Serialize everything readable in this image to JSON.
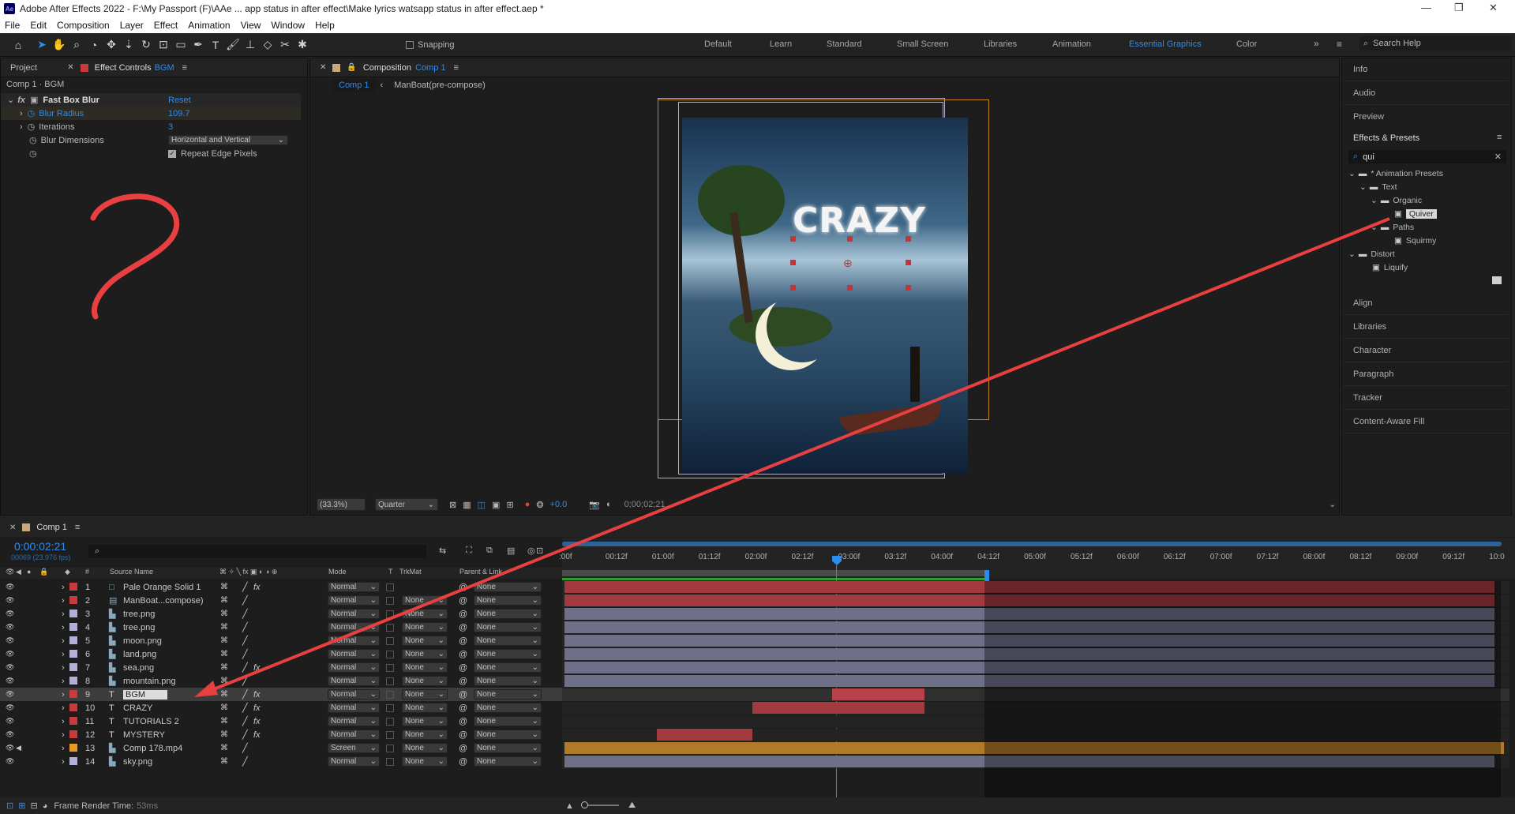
{
  "window": {
    "title": "Adobe After Effects 2022 - F:\\My Passport (F)\\AAe ... app status in after effect\\Make lyrics watsapp status in after effect.aep *",
    "app_badge": "Ae"
  },
  "menu": [
    "File",
    "Edit",
    "Composition",
    "Layer",
    "Effect",
    "Animation",
    "View",
    "Window",
    "Help"
  ],
  "toolbar": {
    "snapping": "Snapping"
  },
  "workspaces": [
    "Default",
    "Learn",
    "Standard",
    "Small Screen",
    "Libraries",
    "Animation",
    "Essential Graphics",
    "Color"
  ],
  "active_workspace": "Essential Graphics",
  "search_help": "Search Help",
  "left_panel": {
    "tabs": [
      "Project",
      "Effect Controls"
    ],
    "effect_controls_layer": "BGM",
    "path": "Comp 1 · BGM",
    "effect": {
      "name": "Fast Box Blur",
      "reset": "Reset",
      "props": [
        {
          "name": "Blur Radius",
          "value": "109.7"
        },
        {
          "name": "Iterations",
          "value": "3"
        },
        {
          "name": "Blur Dimensions",
          "value": "Horizontal and Vertical"
        }
      ],
      "repeat_edge": "Repeat Edge Pixels"
    }
  },
  "comp_panel": {
    "tab_label": "Composition",
    "comp_name": "Comp 1",
    "breadcrumbs": [
      "Comp 1",
      "ManBoat(pre-compose)"
    ],
    "canvas_text": "CRAZY",
    "zoom": "(33.3%)",
    "resolution": "Quarter",
    "exposure": "+0.0",
    "timecode": "0;00;02;21"
  },
  "right_panel": {
    "top_items": [
      "Info",
      "Audio",
      "Preview"
    ],
    "effects_presets": {
      "title": "Effects & Presets",
      "search": "qui",
      "tree": [
        {
          "label": "* Animation Presets",
          "depth": 0,
          "kind": "folder"
        },
        {
          "label": "Text",
          "depth": 1,
          "kind": "folder"
        },
        {
          "label": "Organic",
          "depth": 2,
          "kind": "folder"
        },
        {
          "label": "Quiver",
          "depth": 3,
          "kind": "preset",
          "selected": true
        },
        {
          "label": "Paths",
          "depth": 2,
          "kind": "folder"
        },
        {
          "label": "Squirmy",
          "depth": 3,
          "kind": "preset"
        },
        {
          "label": "Distort",
          "depth": 0,
          "kind": "folder"
        },
        {
          "label": "Liquify",
          "depth": 1,
          "kind": "preset"
        }
      ]
    },
    "bottom_items": [
      "Align",
      "Libraries",
      "Character",
      "Paragraph",
      "Tracker",
      "Content-Aware Fill"
    ]
  },
  "timeline": {
    "tab": "Comp 1",
    "timecode": "0:00:02:21",
    "frame_info": "00069 (23.976 fps)",
    "columns": {
      "source": "Source Name",
      "mode": "Mode",
      "t": "T",
      "trkmat": "TrkMat",
      "parent": "Parent & Link"
    },
    "ruler": [
      ":00f",
      "00:12f",
      "01:00f",
      "01:12f",
      "02:00f",
      "02:12f",
      "03:00f",
      "03:12f",
      "04:00f",
      "04:12f",
      "05:00f",
      "05:12f",
      "06:00f",
      "06:12f",
      "07:00f",
      "07:12f",
      "08:00f",
      "08:12f",
      "09:00f",
      "09:12f",
      "10:0"
    ],
    "layers": [
      {
        "num": "1",
        "name": "Pale Orange Solid 1",
        "type": "solid",
        "label": "#c93a3a",
        "mode": "Normal",
        "trk": "",
        "parent": "None",
        "bar": [
          0,
          0.99
        ],
        "barcolor": "#a23a3f",
        "fx": true
      },
      {
        "num": "2",
        "name": "ManBoat...compose)",
        "type": "comp",
        "label": "#c93a3a",
        "mode": "Normal",
        "trk": "None",
        "parent": "None",
        "bar": [
          0,
          0.99
        ],
        "barcolor": "#a23a3f",
        "fx": false
      },
      {
        "num": "3",
        "name": "tree.png",
        "type": "footage",
        "label": "#b0b0d8",
        "mode": "Normal",
        "trk": "None",
        "parent": "None",
        "bar": [
          0,
          0.99
        ],
        "barcolor": "#6e7088",
        "fx": false
      },
      {
        "num": "4",
        "name": "tree.png",
        "type": "footage",
        "label": "#b0b0d8",
        "mode": "Normal",
        "trk": "None",
        "parent": "None",
        "bar": [
          0,
          0.99
        ],
        "barcolor": "#6e7088",
        "fx": false
      },
      {
        "num": "5",
        "name": "moon.png",
        "type": "footage",
        "label": "#b0b0d8",
        "mode": "Normal",
        "trk": "None",
        "parent": "None",
        "bar": [
          0,
          0.99
        ],
        "barcolor": "#6e7088",
        "fx": false
      },
      {
        "num": "6",
        "name": "land.png",
        "type": "footage",
        "label": "#b0b0d8",
        "mode": "Normal",
        "trk": "None",
        "parent": "None",
        "bar": [
          0,
          0.99
        ],
        "barcolor": "#6e7088",
        "fx": false
      },
      {
        "num": "7",
        "name": "sea.png",
        "type": "footage",
        "label": "#b0b0d8",
        "mode": "Normal",
        "trk": "None",
        "parent": "None",
        "bar": [
          0,
          0.99
        ],
        "barcolor": "#6e7088",
        "fx": true
      },
      {
        "num": "8",
        "name": "mountain.png",
        "type": "footage",
        "label": "#b0b0d8",
        "mode": "Normal",
        "trk": "None",
        "parent": "None",
        "bar": [
          0,
          0.99
        ],
        "barcolor": "#6e7088",
        "fx": false
      },
      {
        "num": "9",
        "name": "BGM",
        "type": "text",
        "label": "#c93a3a",
        "mode": "Normal",
        "trk": "None",
        "parent": "None",
        "bar": [
          0.285,
          0.383
        ],
        "barcolor": "#b7434a",
        "fx": true,
        "selected": true
      },
      {
        "num": "10",
        "name": "CRAZY",
        "type": "text",
        "label": "#c93a3a",
        "mode": "Normal",
        "trk": "None",
        "parent": "None",
        "bar": [
          0.2,
          0.383
        ],
        "barcolor": "#a23a3f",
        "fx": true
      },
      {
        "num": "11",
        "name": "TUTORIALS 2",
        "type": "text",
        "label": "#c93a3a",
        "mode": "Normal",
        "trk": "None",
        "parent": "None",
        "bar": [
          0.0,
          0.0
        ],
        "barcolor": "#a23a3f",
        "fx": true
      },
      {
        "num": "12",
        "name": "MYSTERY",
        "type": "text",
        "label": "#c93a3a",
        "mode": "Normal",
        "trk": "None",
        "parent": "None",
        "bar": [
          0.098,
          0.2
        ],
        "barcolor": "#a23a3f",
        "fx": true
      },
      {
        "num": "13",
        "name": "Comp 178.mp4",
        "type": "footage",
        "label": "#e89a1e",
        "mode": "Screen",
        "trk": "None",
        "parent": "None",
        "bar": [
          0,
          1.0
        ],
        "barcolor": "#b07a28",
        "fx": false
      },
      {
        "num": "14",
        "name": "sky.png",
        "type": "footage",
        "label": "#b0b0d8",
        "mode": "Normal",
        "trk": "None",
        "parent": "None",
        "bar": [
          0,
          0.99
        ],
        "barcolor": "#6e7088",
        "fx": false
      }
    ],
    "frame_render": "Frame Render Time:",
    "frame_render_value": "53ms"
  },
  "colors": {
    "accent": "#2d8ceb",
    "annotation": "#e84040"
  }
}
